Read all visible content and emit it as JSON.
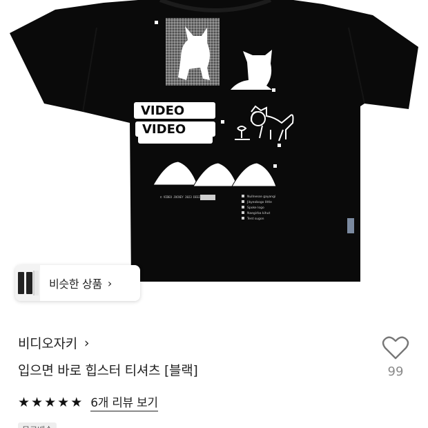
{
  "similar_products": {
    "label": "비슷한 상품"
  },
  "product": {
    "brand": "비디오자키",
    "title": "입으면 바로 힙스터 티셔츠 [블랙]",
    "rating_stars": 5,
    "review_link": "6개 리뷰 보기",
    "like_count": "99",
    "badge": "무료배송"
  },
  "icons": {
    "brand_chevron": "chevron-right-icon",
    "similar_chevron": "chevron-right-icon",
    "like": "heart-outline-icon",
    "star": "star-filled-icon"
  },
  "colors": {
    "shirt": "#0a0a0a",
    "text": "#222222",
    "muted": "#8a8a8a",
    "print": "#ffffff"
  }
}
